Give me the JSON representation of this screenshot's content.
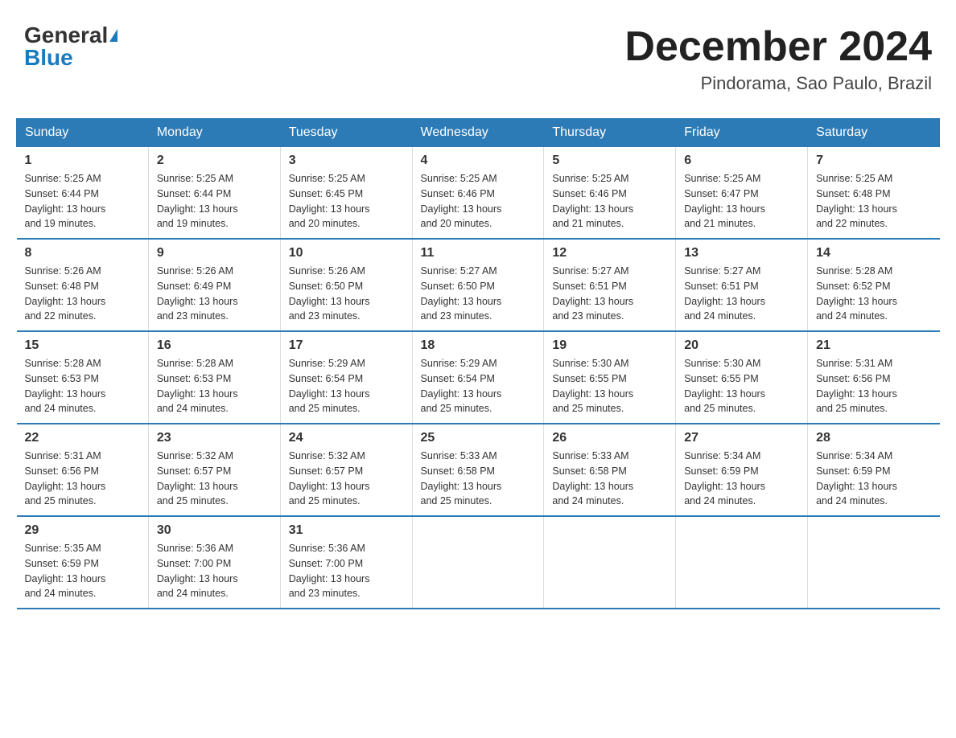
{
  "header": {
    "logo_general": "General",
    "logo_blue": "Blue",
    "month_title": "December 2024",
    "location": "Pindorama, Sao Paulo, Brazil"
  },
  "days_of_week": [
    "Sunday",
    "Monday",
    "Tuesday",
    "Wednesday",
    "Thursday",
    "Friday",
    "Saturday"
  ],
  "weeks": [
    [
      {
        "day": "1",
        "sunrise": "5:25 AM",
        "sunset": "6:44 PM",
        "daylight": "13 hours and 19 minutes."
      },
      {
        "day": "2",
        "sunrise": "5:25 AM",
        "sunset": "6:44 PM",
        "daylight": "13 hours and 19 minutes."
      },
      {
        "day": "3",
        "sunrise": "5:25 AM",
        "sunset": "6:45 PM",
        "daylight": "13 hours and 20 minutes."
      },
      {
        "day": "4",
        "sunrise": "5:25 AM",
        "sunset": "6:46 PM",
        "daylight": "13 hours and 20 minutes."
      },
      {
        "day": "5",
        "sunrise": "5:25 AM",
        "sunset": "6:46 PM",
        "daylight": "13 hours and 21 minutes."
      },
      {
        "day": "6",
        "sunrise": "5:25 AM",
        "sunset": "6:47 PM",
        "daylight": "13 hours and 21 minutes."
      },
      {
        "day": "7",
        "sunrise": "5:25 AM",
        "sunset": "6:48 PM",
        "daylight": "13 hours and 22 minutes."
      }
    ],
    [
      {
        "day": "8",
        "sunrise": "5:26 AM",
        "sunset": "6:48 PM",
        "daylight": "13 hours and 22 minutes."
      },
      {
        "day": "9",
        "sunrise": "5:26 AM",
        "sunset": "6:49 PM",
        "daylight": "13 hours and 23 minutes."
      },
      {
        "day": "10",
        "sunrise": "5:26 AM",
        "sunset": "6:50 PM",
        "daylight": "13 hours and 23 minutes."
      },
      {
        "day": "11",
        "sunrise": "5:27 AM",
        "sunset": "6:50 PM",
        "daylight": "13 hours and 23 minutes."
      },
      {
        "day": "12",
        "sunrise": "5:27 AM",
        "sunset": "6:51 PM",
        "daylight": "13 hours and 23 minutes."
      },
      {
        "day": "13",
        "sunrise": "5:27 AM",
        "sunset": "6:51 PM",
        "daylight": "13 hours and 24 minutes."
      },
      {
        "day": "14",
        "sunrise": "5:28 AM",
        "sunset": "6:52 PM",
        "daylight": "13 hours and 24 minutes."
      }
    ],
    [
      {
        "day": "15",
        "sunrise": "5:28 AM",
        "sunset": "6:53 PM",
        "daylight": "13 hours and 24 minutes."
      },
      {
        "day": "16",
        "sunrise": "5:28 AM",
        "sunset": "6:53 PM",
        "daylight": "13 hours and 24 minutes."
      },
      {
        "day": "17",
        "sunrise": "5:29 AM",
        "sunset": "6:54 PM",
        "daylight": "13 hours and 25 minutes."
      },
      {
        "day": "18",
        "sunrise": "5:29 AM",
        "sunset": "6:54 PM",
        "daylight": "13 hours and 25 minutes."
      },
      {
        "day": "19",
        "sunrise": "5:30 AM",
        "sunset": "6:55 PM",
        "daylight": "13 hours and 25 minutes."
      },
      {
        "day": "20",
        "sunrise": "5:30 AM",
        "sunset": "6:55 PM",
        "daylight": "13 hours and 25 minutes."
      },
      {
        "day": "21",
        "sunrise": "5:31 AM",
        "sunset": "6:56 PM",
        "daylight": "13 hours and 25 minutes."
      }
    ],
    [
      {
        "day": "22",
        "sunrise": "5:31 AM",
        "sunset": "6:56 PM",
        "daylight": "13 hours and 25 minutes."
      },
      {
        "day": "23",
        "sunrise": "5:32 AM",
        "sunset": "6:57 PM",
        "daylight": "13 hours and 25 minutes."
      },
      {
        "day": "24",
        "sunrise": "5:32 AM",
        "sunset": "6:57 PM",
        "daylight": "13 hours and 25 minutes."
      },
      {
        "day": "25",
        "sunrise": "5:33 AM",
        "sunset": "6:58 PM",
        "daylight": "13 hours and 25 minutes."
      },
      {
        "day": "26",
        "sunrise": "5:33 AM",
        "sunset": "6:58 PM",
        "daylight": "13 hours and 24 minutes."
      },
      {
        "day": "27",
        "sunrise": "5:34 AM",
        "sunset": "6:59 PM",
        "daylight": "13 hours and 24 minutes."
      },
      {
        "day": "28",
        "sunrise": "5:34 AM",
        "sunset": "6:59 PM",
        "daylight": "13 hours and 24 minutes."
      }
    ],
    [
      {
        "day": "29",
        "sunrise": "5:35 AM",
        "sunset": "6:59 PM",
        "daylight": "13 hours and 24 minutes."
      },
      {
        "day": "30",
        "sunrise": "5:36 AM",
        "sunset": "7:00 PM",
        "daylight": "13 hours and 24 minutes."
      },
      {
        "day": "31",
        "sunrise": "5:36 AM",
        "sunset": "7:00 PM",
        "daylight": "13 hours and 23 minutes."
      },
      null,
      null,
      null,
      null
    ]
  ],
  "labels": {
    "sunrise": "Sunrise:",
    "sunset": "Sunset:",
    "daylight": "Daylight:"
  }
}
